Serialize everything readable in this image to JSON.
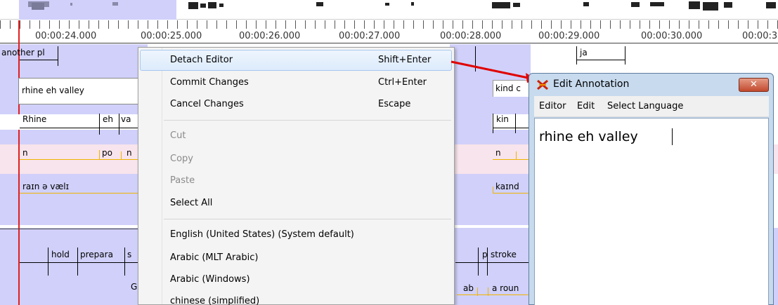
{
  "timeline": {
    "ruler_labels": [
      "00:00:24.000",
      "00:00:25.000",
      "00:00:26.000",
      "00:00:27.000",
      "00:00:28.000",
      "00:00:29.000",
      "00:00:30.000",
      "00:00:3"
    ]
  },
  "annotations": {
    "tier1": [
      "another pl",
      "ja"
    ],
    "edit_field_value": "rhine eh valley",
    "kind_partial": "kind c",
    "tier3": [
      "Rhine",
      "eh",
      "va",
      "kin"
    ],
    "tier4": [
      "n",
      "po",
      "n",
      "n"
    ],
    "tier5": [
      "raɪn ə vælɪ",
      "kaɪnd"
    ],
    "tier6": [
      "hold",
      "prepara",
      "s",
      "p",
      "stroke"
    ],
    "tier7": [
      "G",
      "ab",
      "a roun"
    ]
  },
  "context_menu": {
    "items": [
      {
        "label": "Detach Editor",
        "shortcut": "Shift+Enter",
        "enabled": true,
        "highlighted": true
      },
      {
        "label": "Commit Changes",
        "shortcut": "Ctrl+Enter",
        "enabled": true
      },
      {
        "label": "Cancel Changes",
        "shortcut": "Escape",
        "enabled": true
      },
      {
        "label": "Cut",
        "shortcut": "",
        "enabled": false
      },
      {
        "label": "Copy",
        "shortcut": "",
        "enabled": false
      },
      {
        "label": "Paste",
        "shortcut": "",
        "enabled": false
      },
      {
        "label": "Select All",
        "shortcut": "",
        "enabled": true
      },
      {
        "label": "English (United States) (System default)",
        "shortcut": "",
        "enabled": true
      },
      {
        "label": "Arabic (MLT Arabic)",
        "shortcut": "",
        "enabled": true
      },
      {
        "label": "Arabic (Windows)",
        "shortcut": "",
        "enabled": true
      },
      {
        "label": "chinese (simplified)",
        "shortcut": "",
        "enabled": true
      }
    ]
  },
  "edit_dialog": {
    "title": "Edit Annotation",
    "close_label": "✕",
    "menu": [
      "Editor",
      "Edit",
      "Select Language"
    ],
    "text": "rhine eh valley"
  },
  "colors": {
    "tier_purple": "#d0d0fa",
    "tier_pink": "#f8e4ec",
    "cursor_red": "#e02020",
    "orange_ref": "#f0b400",
    "dialog_frame": "#c7daee"
  },
  "icons": [
    "elan-app-icon",
    "close-icon"
  ]
}
